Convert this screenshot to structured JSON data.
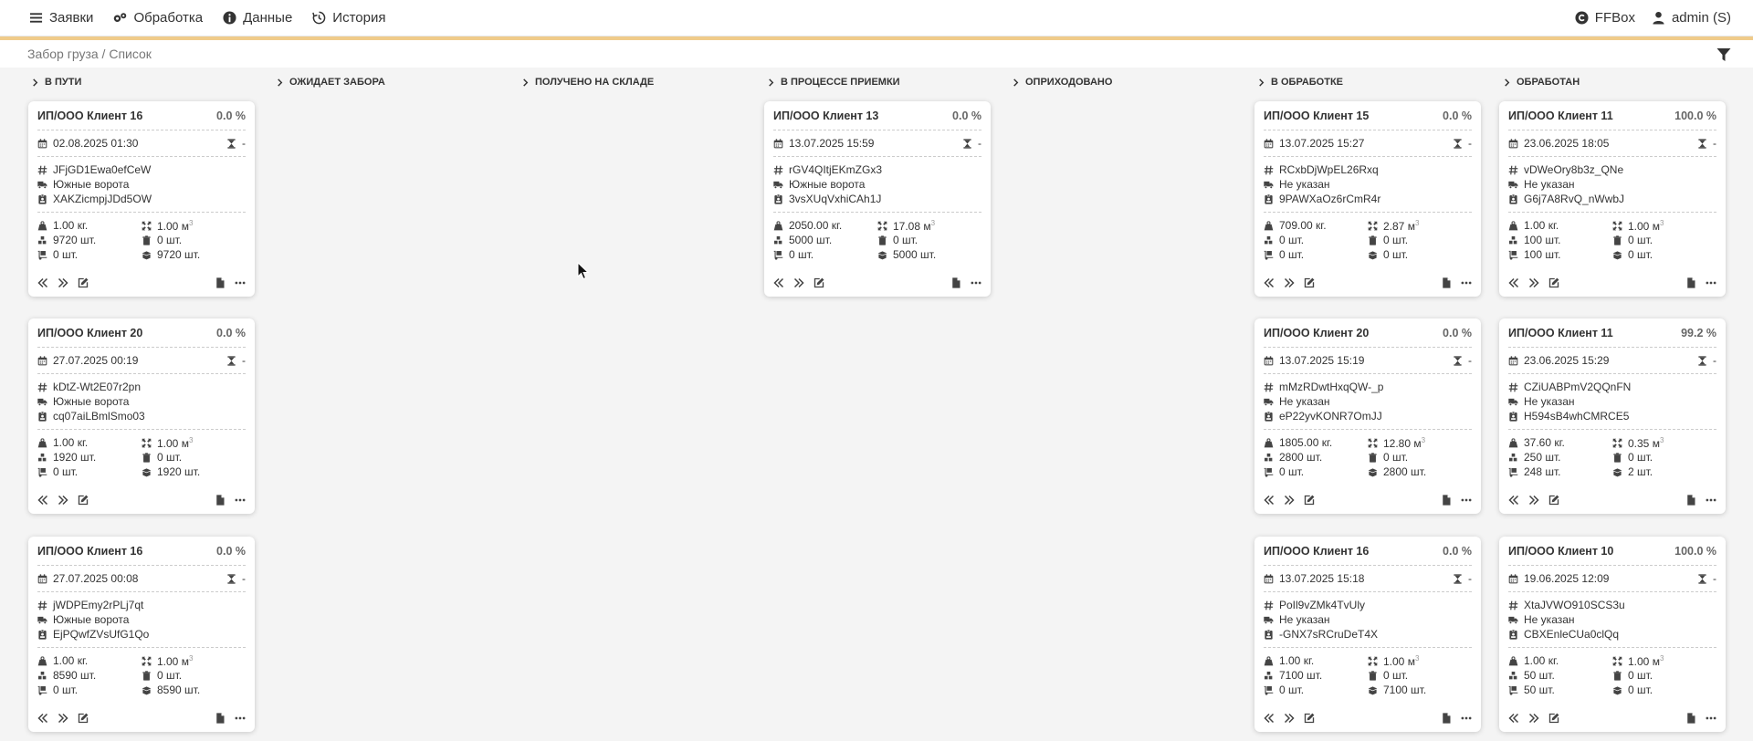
{
  "nav": {
    "items": [
      {
        "label": "Заявки",
        "icon": "menu-icon"
      },
      {
        "label": "Обработка",
        "icon": "gears-icon"
      },
      {
        "label": "Данные",
        "icon": "info-icon"
      },
      {
        "label": "История",
        "icon": "history-icon"
      }
    ],
    "right": [
      {
        "label": "FFBox",
        "icon": "copyright-icon"
      },
      {
        "label": "admin (S)",
        "icon": "user-icon"
      }
    ]
  },
  "breadcrumb": "Забор груза / Список",
  "columns": [
    "В ПУТИ",
    "ОЖИДАЕТ ЗАБОРА",
    "ПОЛУЧЕНО НА СКЛАДЕ",
    "В ПРОЦЕССЕ ПРИЕМКИ",
    "ОПРИХОДОВАНО",
    "В ОБРАБОТКЕ",
    "ОБРАБОТАН"
  ],
  "cards": [
    {
      "client": "ИП/ООО Клиент 16",
      "pct": "0.0 %",
      "date": "02.08.2025 01:30",
      "dur": "-",
      "code": "JFjGD1Ewa0efCeW",
      "gate": "Южные ворота",
      "doc": "XAKZicmpjJDd5OW",
      "weight": "1.00 кг.",
      "volume": "1.00 м",
      "volsup": "3",
      "qty1": "9720 шт.",
      "qty2": "0 шт.",
      "qty3": "0 шт.",
      "qty4": "9720 шт."
    },
    {
      "client": "ИП/ООО Клиент 20",
      "pct": "0.0 %",
      "date": "27.07.2025 00:19",
      "dur": "-",
      "code": "kDtZ-Wt2E07r2pn",
      "gate": "Южные ворота",
      "doc": "cq07aiLBmlSmo03",
      "weight": "1.00 кг.",
      "volume": "1.00 м",
      "volsup": "3",
      "qty1": "1920 шт.",
      "qty2": "0 шт.",
      "qty3": "0 шт.",
      "qty4": "1920 шт."
    },
    {
      "client": "ИП/ООО Клиент 16",
      "pct": "0.0 %",
      "date": "27.07.2025 00:08",
      "dur": "-",
      "code": "jWDPEmy2rPLj7qt",
      "gate": "Южные ворота",
      "doc": "EjPQwfZVsUfG1Qo",
      "weight": "1.00 кг.",
      "volume": "1.00 м",
      "volsup": "3",
      "qty1": "8590 шт.",
      "qty2": "0 шт.",
      "qty3": "0 шт.",
      "qty4": "8590 шт."
    },
    {
      "client": "ИП/ООО Клиент 13",
      "pct": "0.0 %",
      "date": "13.07.2025 15:59",
      "dur": "-",
      "code": "rGV4QItjEKmZGx3",
      "gate": "Южные ворота",
      "doc": "3vsXUqVxhiCAh1J",
      "weight": "2050.00 кг.",
      "volume": "17.08 м",
      "volsup": "3",
      "qty1": "5000 шт.",
      "qty2": "0 шт.",
      "qty3": "0 шт.",
      "qty4": "5000 шт."
    },
    {
      "client": "ИП/ООО Клиент 15",
      "pct": "0.0 %",
      "date": "13.07.2025 15:27",
      "dur": "-",
      "code": "RCxbDjWpEL26Rxq",
      "gate": "Не указан",
      "doc": "9PAWXaOz6rCmR4r",
      "weight": "709.00 кг.",
      "volume": "2.87 м",
      "volsup": "3",
      "qty1": "0 шт.",
      "qty2": "0 шт.",
      "qty3": "0 шт.",
      "qty4": "0 шт."
    },
    {
      "client": "ИП/ООО Клиент 20",
      "pct": "0.0 %",
      "date": "13.07.2025 15:19",
      "dur": "-",
      "code": "mMzRDwtHxqQW-_p",
      "gate": "Не указан",
      "doc": "eP22yvKONR7OmJJ",
      "weight": "1805.00 кг.",
      "volume": "12.80 м",
      "volsup": "3",
      "qty1": "2800 шт.",
      "qty2": "0 шт.",
      "qty3": "0 шт.",
      "qty4": "2800 шт."
    },
    {
      "client": "ИП/ООО Клиент 16",
      "pct": "0.0 %",
      "date": "13.07.2025 15:18",
      "dur": "-",
      "code": "PoIl9vZMk4TvUly",
      "gate": "Не указан",
      "doc": "-GNX7sRCruDeT4X",
      "weight": "1.00 кг.",
      "volume": "1.00 м",
      "volsup": "3",
      "qty1": "7100 шт.",
      "qty2": "0 шт.",
      "qty3": "0 шт.",
      "qty4": "7100 шт."
    },
    {
      "client": "ИП/ООО Клиент 11",
      "pct": "100.0 %",
      "date": "23.06.2025 18:05",
      "dur": "-",
      "code": "vDWeOry8b3z_QNe",
      "gate": "Не указан",
      "doc": "G6j7A8RvQ_nWwbJ",
      "weight": "1.00 кг.",
      "volume": "1.00 м",
      "volsup": "3",
      "qty1": "100 шт.",
      "qty2": "0 шт.",
      "qty3": "100 шт.",
      "qty4": "0 шт."
    },
    {
      "client": "ИП/ООО Клиент 11",
      "pct": "99.2 %",
      "date": "23.06.2025 15:29",
      "dur": "-",
      "code": "CZiUABPmV2QQnFN",
      "gate": "Не указан",
      "doc": "H594sB4whCMRCE5",
      "weight": "37.60 кг.",
      "volume": "0.35 м",
      "volsup": "3",
      "qty1": "250 шт.",
      "qty2": "0 шт.",
      "qty3": "248 шт.",
      "qty4": "2 шт."
    },
    {
      "client": "ИП/ООО Клиент 10",
      "pct": "100.0 %",
      "date": "19.06.2025 12:09",
      "dur": "-",
      "code": "XtaJVWO910SCS3u",
      "gate": "Не указан",
      "doc": "CBXEnleCUa0clQq",
      "weight": "1.00 кг.",
      "volume": "1.00 м",
      "volsup": "3",
      "qty1": "50 шт.",
      "qty2": "0 шт.",
      "qty3": "50 шт.",
      "qty4": "0 шт."
    }
  ]
}
